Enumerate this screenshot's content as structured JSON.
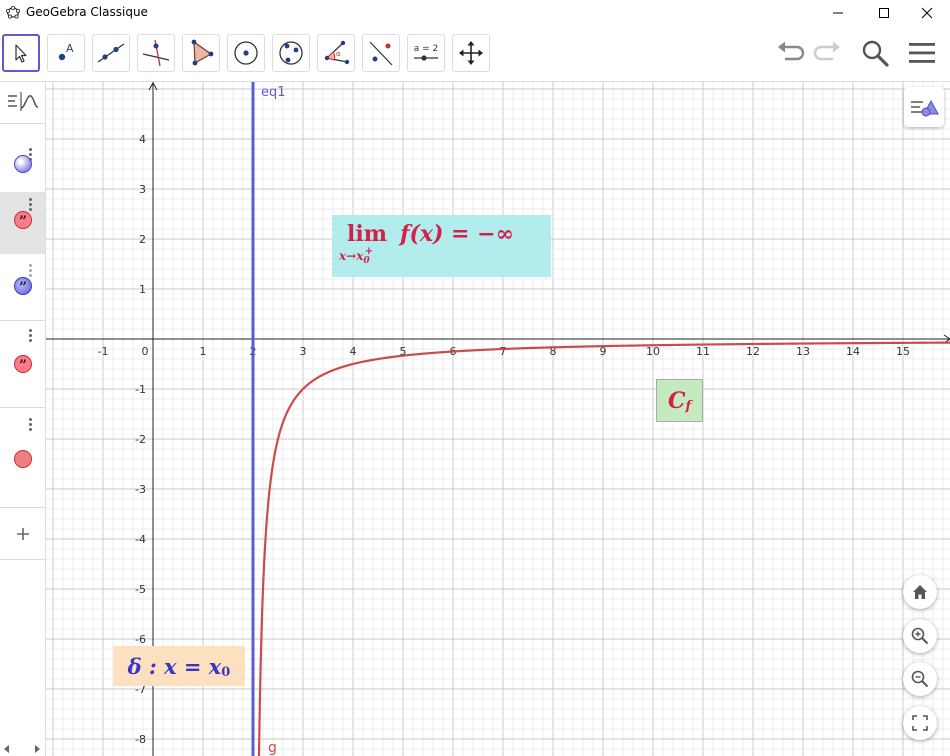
{
  "window": {
    "title": "GeoGebra Classique"
  },
  "toolbar": {
    "tools": [
      "move-tool",
      "point-tool",
      "line-tool",
      "perpendicular-line-tool",
      "polygon-tool",
      "circle-center-point-tool",
      "circle-three-points-tool",
      "angle-tool",
      "reflect-tool",
      "slider-tool",
      "move-graphics-view-tool"
    ],
    "slider_tool_label": "a = 2"
  },
  "graphics": {
    "x_ticks": [
      "-1",
      "0",
      "1",
      "2",
      "3",
      "4",
      "5",
      "6",
      "7",
      "8",
      "9",
      "10",
      "11",
      "12",
      "13",
      "14",
      "15"
    ],
    "y_ticks_pos": [
      "1",
      "2",
      "3",
      "4"
    ],
    "y_ticks_neg": [
      "-1",
      "-2",
      "-3",
      "-4",
      "-5",
      "-6",
      "-7",
      "-8"
    ],
    "line_label": "eq1",
    "curve_label": "g",
    "colors": {
      "asymptote": "#5b5bd6",
      "curve": "#c94c4c",
      "limit_bg": "#b3ecec",
      "limit_text": "#d1204a",
      "cf_bg": "#c6eac0",
      "delta_bg": "#fde0c0",
      "delta_text": "#3a35c8"
    }
  },
  "labels": {
    "limit_lim": "lim",
    "limit_sub": "x→x",
    "limit_sub_index": "0",
    "limit_sup": "+",
    "limit_expr": "f(x) = −∞",
    "cf_main": "C",
    "cf_sub": "f",
    "delta_text": "δ : x = x",
    "delta_sub": "0"
  }
}
